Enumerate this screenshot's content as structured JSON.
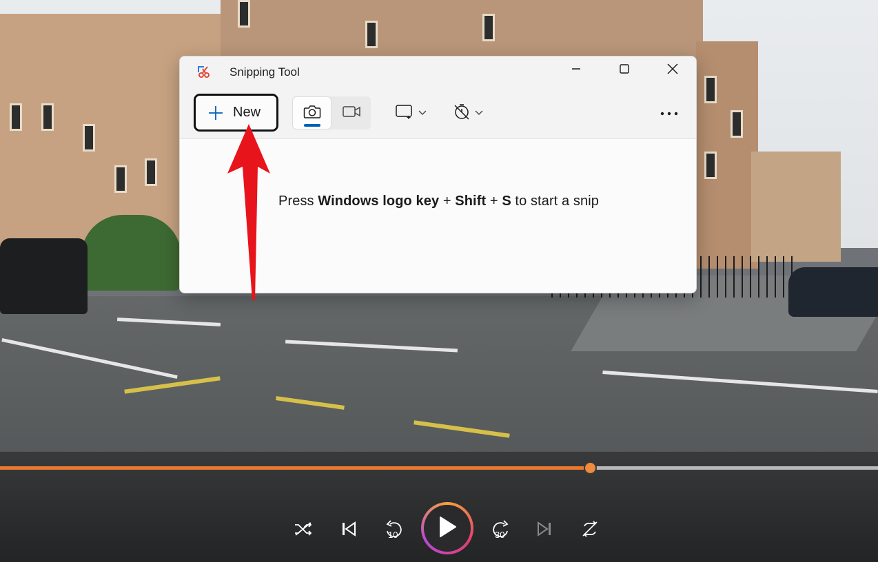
{
  "window": {
    "title": "Snipping Tool",
    "new_button_label": "New",
    "hint_prefix": "Press ",
    "hint_bold_1": "Windows logo key",
    "hint_plus_1": " + ",
    "hint_bold_2": "Shift",
    "hint_plus_2": " + ",
    "hint_bold_3": "S",
    "hint_suffix": " to start a snip",
    "selected_mode": "screenshot"
  },
  "player": {
    "progress": 0.672,
    "rewind_seconds": "10",
    "forward_seconds": "30"
  },
  "colors": {
    "accent": "#005fb8",
    "arrow": "#e8141b",
    "seek_fill": "#e9792f"
  }
}
